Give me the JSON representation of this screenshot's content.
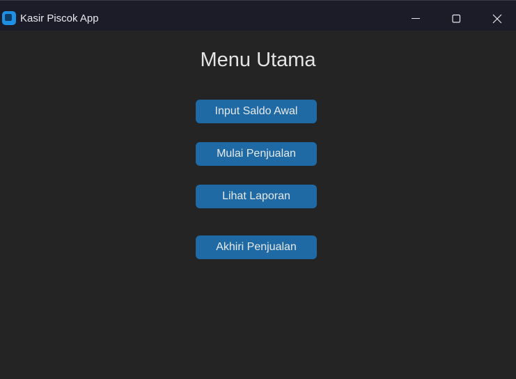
{
  "window": {
    "title": "Kasir Piscok App",
    "icon": "app-icon",
    "controls": [
      "minimize-icon",
      "maximize-icon",
      "close-icon"
    ]
  },
  "main": {
    "heading": "Menu Utama",
    "buttons": [
      {
        "label": "Input Saldo Awal"
      },
      {
        "label": "Mulai Penjualan"
      },
      {
        "label": "Lihat Laporan"
      },
      {
        "label": "Akhiri Penjualan"
      }
    ]
  },
  "colors": {
    "background": "#242424",
    "titlebar": "#1c1b28",
    "button": "#1f6aa5",
    "text": "#e4e4e4"
  }
}
